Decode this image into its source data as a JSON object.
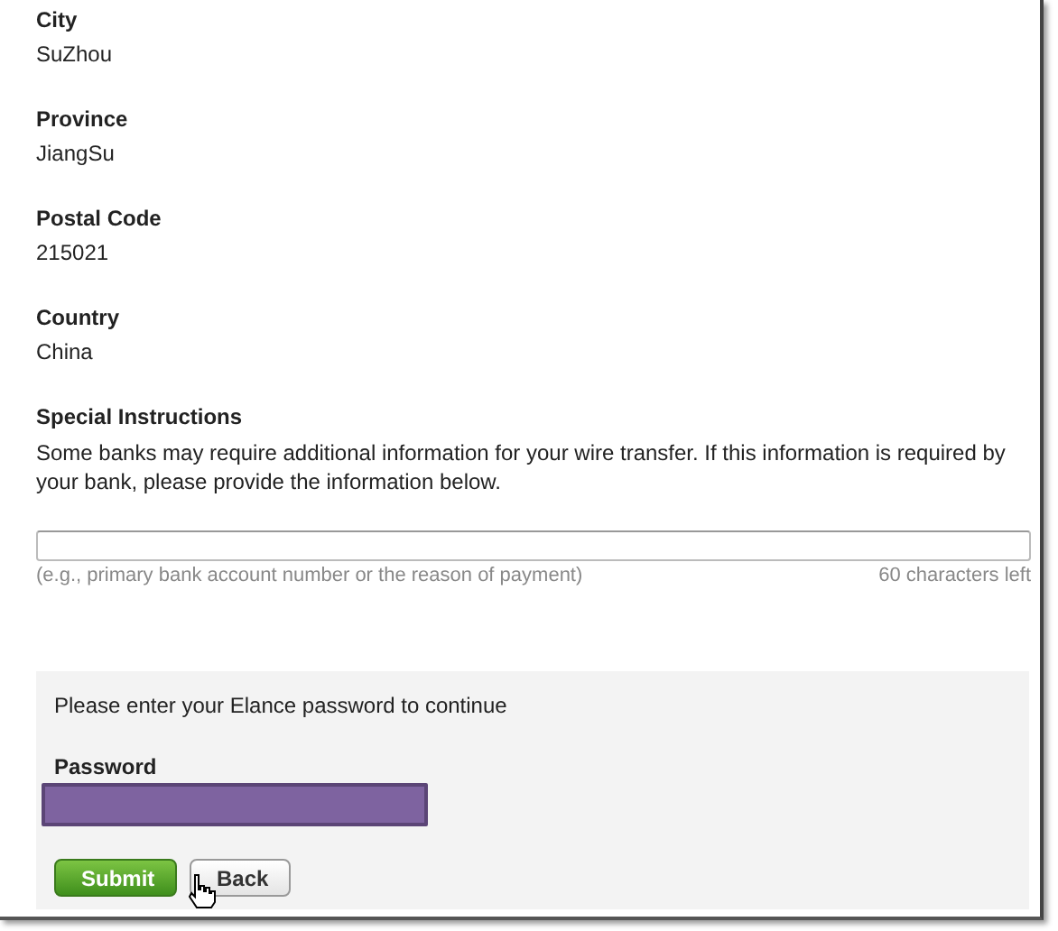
{
  "fields": [
    {
      "label": "City",
      "value": "SuZhou"
    },
    {
      "label": "Province",
      "value": "JiangSu"
    },
    {
      "label": "Postal Code",
      "value": "215021"
    },
    {
      "label": "Country",
      "value": "China"
    }
  ],
  "special_instructions": {
    "label": "Special Instructions",
    "description": "Some banks may require additional information for your wire transfer. If this information is required by your bank, please provide the information below.",
    "hint": "(e.g., primary bank account number or the reason of payment)",
    "counter": "60 characters left"
  },
  "password_panel": {
    "prompt": "Please enter your Elance password to continue",
    "label": "Password",
    "buttons": [
      {
        "label": "Submit",
        "kind": "primary"
      },
      {
        "label": "Back",
        "kind": "secondary"
      }
    ]
  }
}
